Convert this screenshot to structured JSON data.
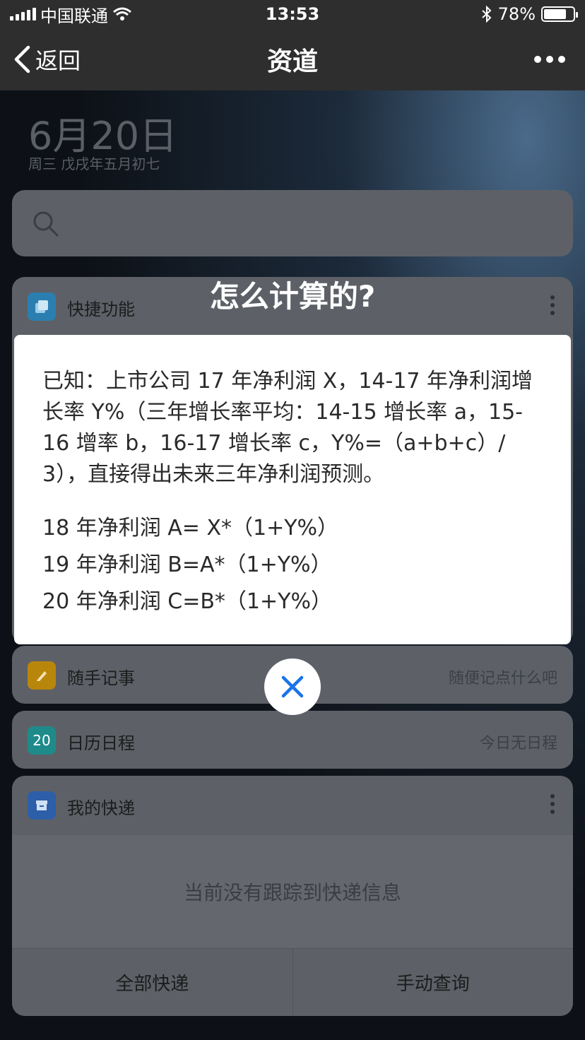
{
  "status_bar": {
    "carrier": "中国联通",
    "time": "13:53",
    "battery_percent": "78%",
    "battery_level": 0.78
  },
  "nav": {
    "back_label": "返回",
    "title": "资道"
  },
  "widget_page": {
    "date": "6月20日",
    "lunar": "周三 戊戌年五月初七",
    "cards": {
      "shortcuts": {
        "title": "快捷功能"
      },
      "notes": {
        "title": "随手记事",
        "hint": "随便记点什么吧"
      },
      "calendar": {
        "title": "日历日程",
        "hint": "今日无日程",
        "icon_text": "20"
      },
      "express": {
        "title": "我的快递",
        "empty_text": "当前没有跟踪到快递信息",
        "action_all": "全部快递",
        "action_query": "手动查询"
      }
    }
  },
  "dialog": {
    "title": "怎么计算的?",
    "paragraph": "已知：上市公司 17 年净利润 X，14-17 年净利润增长率 Y%（三年增长率平均：14-15 增长率 a，15-16 增率 b，16-17 增长率 c，Y%=（a+b+c）/ 3），直接得出未来三年净利润预测。",
    "formulas": [
      "18 年净利润 A= X*（1+Y%）",
      "19 年净利润 B=A*（1+Y%）",
      "20 年净利润 C=B*（1+Y%）"
    ]
  },
  "colors": {
    "accent": "#1a73e8",
    "nav_bg": "#2e2e2e",
    "note_icon": "#b8860b",
    "calendar_icon": "#1f8a8a",
    "express_icon": "#2c5fa8",
    "shortcut_icon": "#2a7fb0"
  }
}
